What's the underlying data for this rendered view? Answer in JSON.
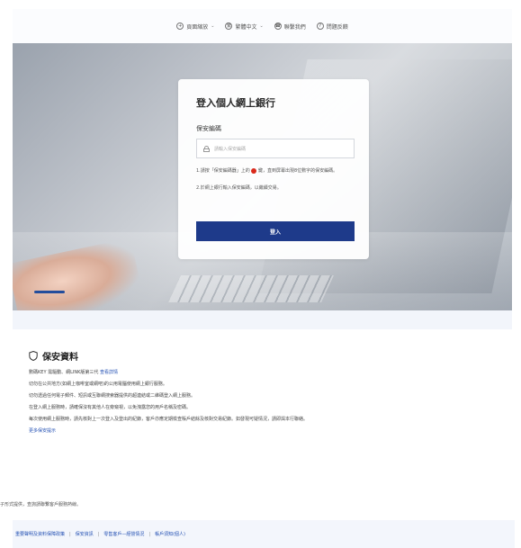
{
  "topbar": {
    "items": [
      {
        "label": "頁面縮放",
        "icon": "+",
        "has_caret": true
      },
      {
        "label": "繁體中文",
        "icon": "繁",
        "has_caret": true
      },
      {
        "label": "聯繫我們",
        "icon": "☎",
        "has_caret": false
      },
      {
        "label": "問題反饋",
        "icon": "?",
        "has_caret": false
      }
    ]
  },
  "login": {
    "title": "登入個人網上銀行",
    "field_label": "保安編碼",
    "input_placeholder": "請輸入保安編碼",
    "hint1_part1": "1.請按「保安編碼器」上的",
    "hint1_part2": "鍵，直到屏幕出現8位數字的保安編碼。",
    "hint2": "2.於網上銀行輸入保安編碼，以繼續交易。",
    "button_label": "登入"
  },
  "security": {
    "title": "保安資料",
    "line1_text": "數碼KEY 需驅動、網LINK版第三代",
    "line1_link": "查看詳情",
    "line2": "切勿在公共地方(如網上咖啡室或網吧)的公用電腦使用網上銀行服務。",
    "line3": "切勿透過任何電子郵件、短訊或互聯網搜索器提供的超連結或二維碼登入網上服務。",
    "line4": "在登入網上服務時，請確保沒有其他人在旁窺視，以免洩露您的用戶名稱及密碼。",
    "line5": "每次使用網上服務時，請先核對上一次登入及登出的紀錄，客戶亦應定期檢查賬戶結餘及核對交易紀錄。如發現可疑情況，請即與本行聯絡。",
    "more_link": "更多保安提示"
  },
  "notice": "子形式提供，查詢請聯繫客戶服務熱線。",
  "footer": {
    "links": [
      "重要聲明及資料保障政策",
      "保安資訊",
      "零售客戶—經營情況",
      "帳戶須知(個人)"
    ]
  },
  "colors": {
    "primary": "#1e3a8a",
    "link": "#2350b3",
    "alert_red": "#d9291b"
  }
}
